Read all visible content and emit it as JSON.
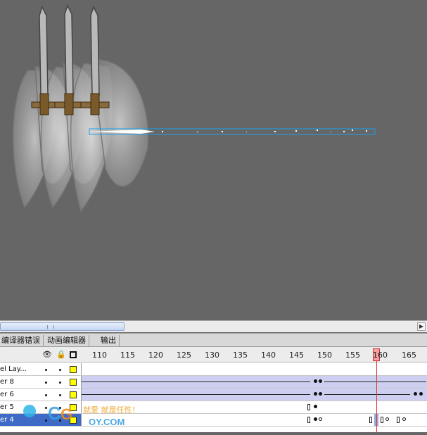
{
  "tabs": [
    {
      "label": "编译器错误"
    },
    {
      "label": "动画编辑器"
    },
    {
      "label": "输出"
    }
  ],
  "ruler": [
    "110",
    "115",
    "120",
    "125",
    "130",
    "135",
    "140",
    "145",
    "150",
    "155",
    "160",
    "165"
  ],
  "layers": [
    {
      "name": "el Lay..."
    },
    {
      "name": "er 8"
    },
    {
      "name": "er 6"
    },
    {
      "name": "er 5"
    },
    {
      "name": "er 4"
    }
  ],
  "playhead_frame": "160",
  "watermark": {
    "line1": "就爱 就是任性！",
    "line2": "OY.COM"
  },
  "colors": {
    "stage": "#666666",
    "tween": "#cccff0",
    "playhead": "#e03030",
    "layer_box": "#ffff00"
  }
}
